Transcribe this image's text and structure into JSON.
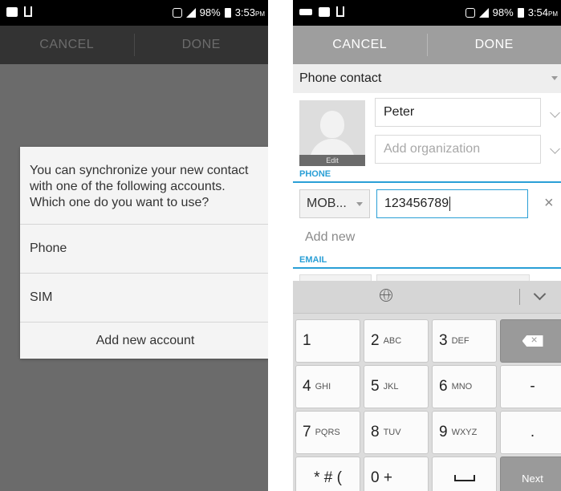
{
  "left": {
    "status": {
      "time": "3:53",
      "ampm": "PM",
      "battery": "98%"
    },
    "actionbar": {
      "cancel": "CANCEL",
      "done": "DONE"
    },
    "dialog": {
      "message": "You can synchronize your new contact with one of the following accounts. Which one do you want to use?",
      "options": [
        "Phone",
        "SIM"
      ],
      "add_account": "Add new account"
    }
  },
  "right": {
    "status": {
      "time": "3:54",
      "ampm": "PM",
      "battery": "98%"
    },
    "actionbar": {
      "cancel": "CANCEL",
      "done": "DONE"
    },
    "account": "Phone contact",
    "photo_edit": "Edit",
    "name_value": "Peter",
    "org_placeholder": "Add organization",
    "phone_section": "PHONE",
    "phone_type": "MOB...",
    "phone_value": "123456789",
    "add_new": "Add new",
    "email_section": "EMAIL"
  },
  "keyboard": {
    "keys": [
      [
        "1",
        ""
      ],
      [
        "2",
        "ABC"
      ],
      [
        "3",
        "DEF"
      ],
      [
        "",
        ""
      ],
      [
        "4",
        "GHI"
      ],
      [
        "5",
        "JKL"
      ],
      [
        "6",
        "MNO"
      ],
      [
        "-",
        ""
      ],
      [
        "7",
        "PQRS"
      ],
      [
        "8",
        "TUV"
      ],
      [
        "9",
        "WXYZ"
      ],
      [
        ".",
        ""
      ],
      [
        "* # (",
        ""
      ],
      [
        "0 +",
        ""
      ],
      [
        "",
        ""
      ],
      [
        "Next",
        ""
      ]
    ]
  },
  "colors": {
    "accent": "#2a9fd6",
    "dim_bg": "#6b6b6b",
    "action_left": "#333333",
    "action_right": "#9e9e9e"
  },
  "icons": [
    "android-icon",
    "usb-icon",
    "vibrate-icon",
    "signal-icon",
    "battery-icon",
    "globe-icon",
    "hide-keyboard-icon",
    "backspace-icon",
    "space-icon",
    "clear-icon",
    "dropdown-icon"
  ]
}
